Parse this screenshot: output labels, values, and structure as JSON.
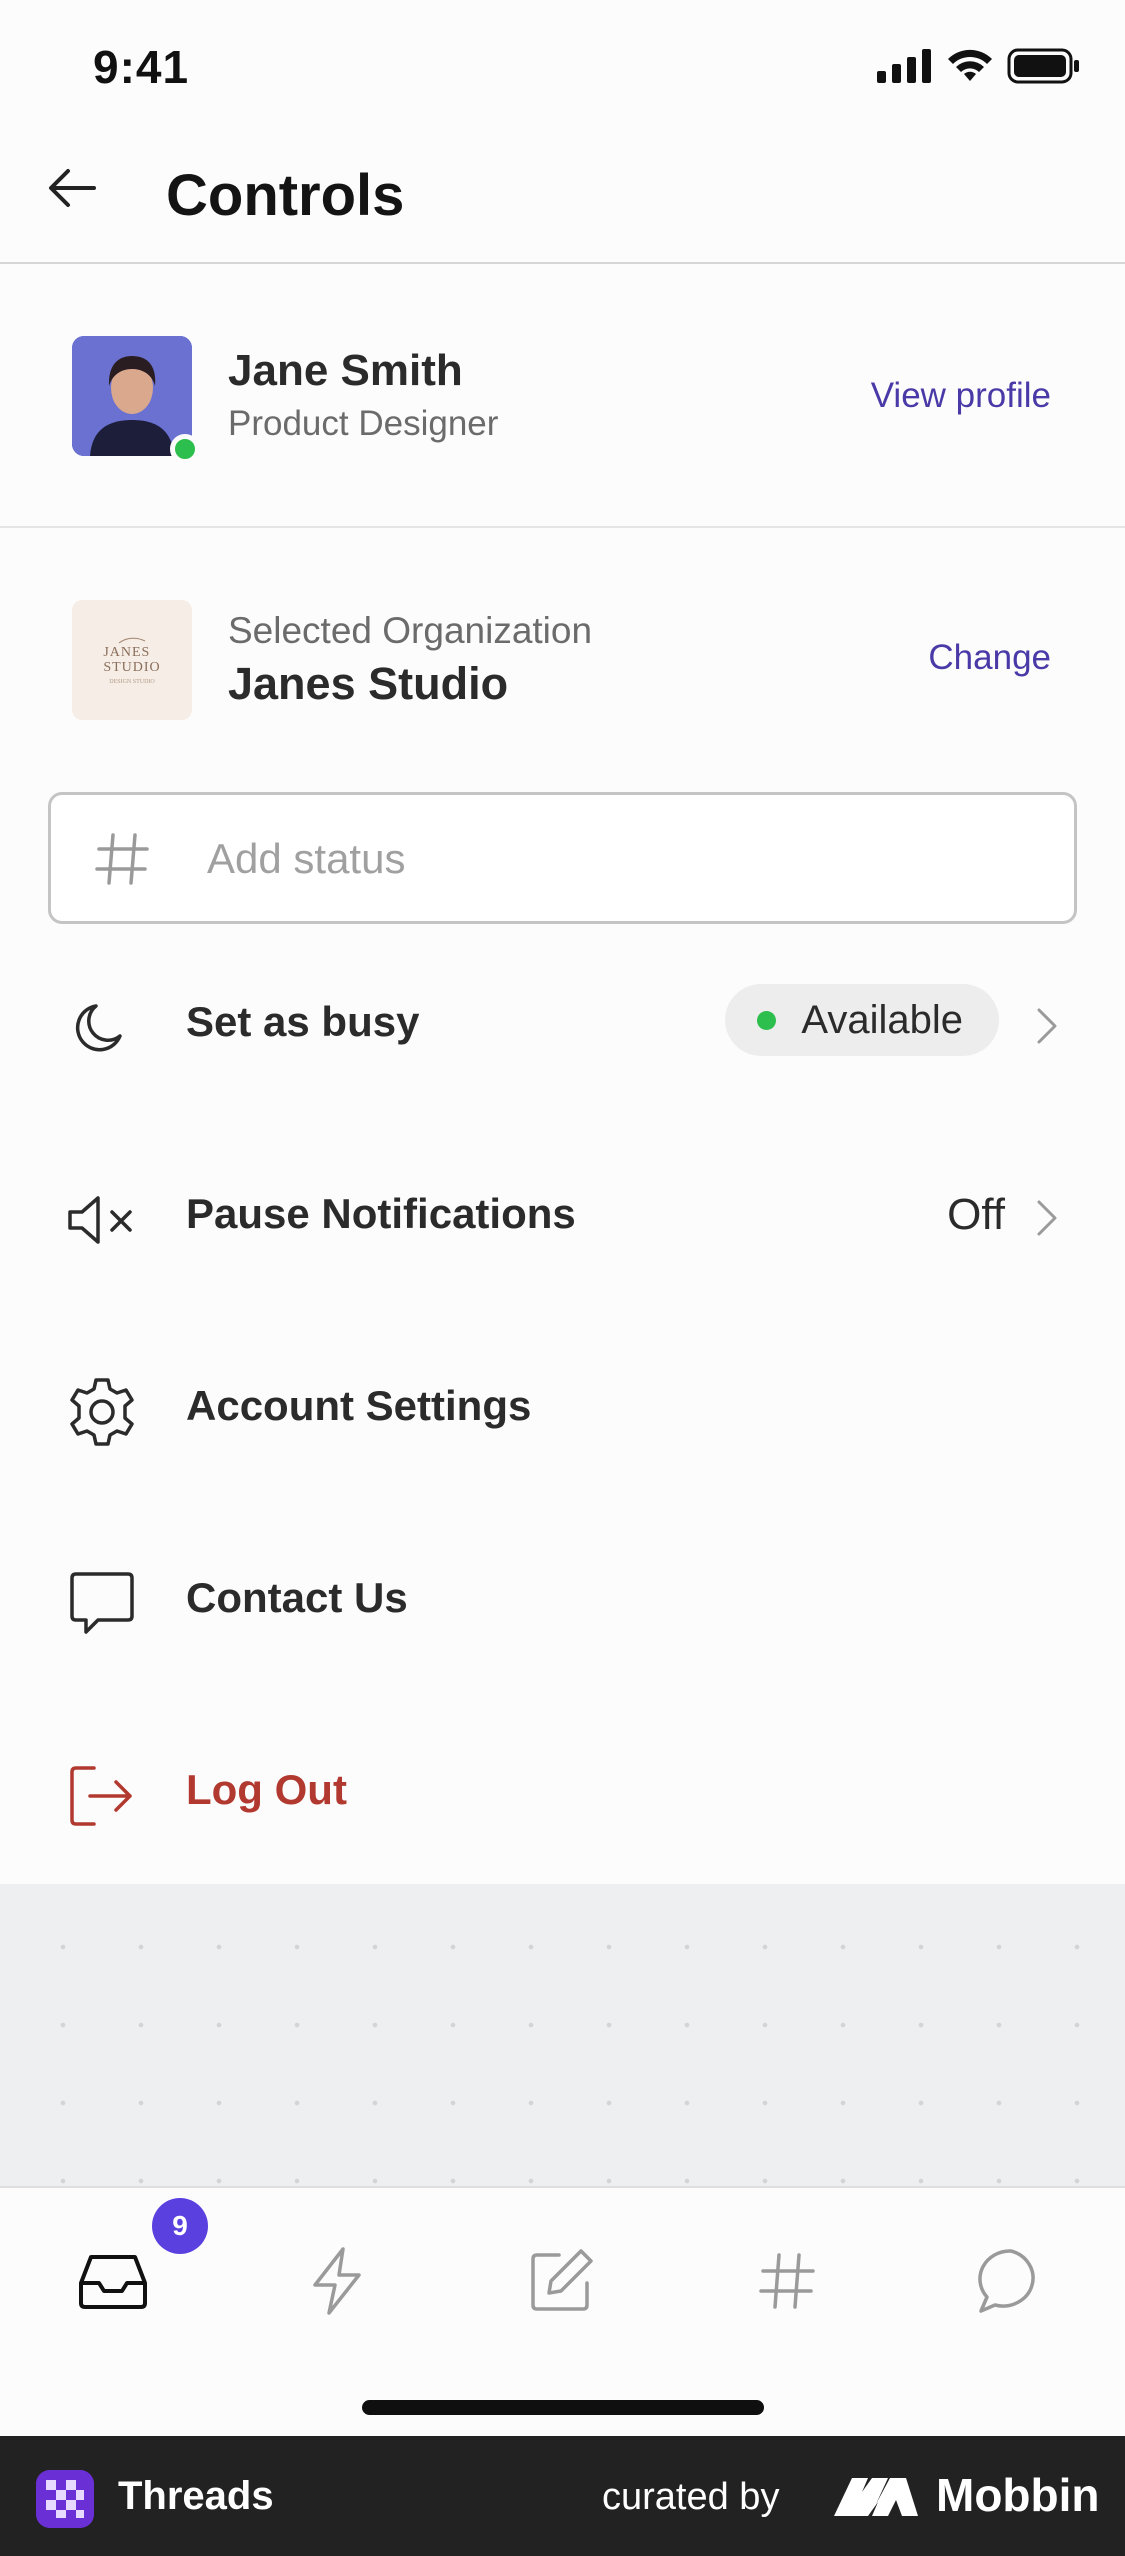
{
  "status_bar": {
    "time": "9:41"
  },
  "header": {
    "title": "Controls",
    "back_icon": "arrow-left-icon"
  },
  "profile": {
    "name": "Jane Smith",
    "role": "Product Designer",
    "presence": "online",
    "view_profile_label": "View profile"
  },
  "organization": {
    "caption": "Selected Organization",
    "name": "Janes Studio",
    "logo_text": "JANES STUDIO",
    "change_label": "Change"
  },
  "status_input": {
    "placeholder": "Add status",
    "icon": "hash-icon"
  },
  "menu": {
    "busy": {
      "label": "Set as busy",
      "icon": "moon-icon",
      "value": "Available"
    },
    "notifications": {
      "label": "Pause Notifications",
      "icon": "speaker-muted-icon",
      "value": "Off"
    },
    "settings": {
      "label": "Account Settings",
      "icon": "gear-icon"
    },
    "contact": {
      "label": "Contact Us",
      "icon": "chat-bubble-icon"
    },
    "logout": {
      "label": "Log Out",
      "icon": "logout-icon"
    }
  },
  "tabbar": {
    "inbox_badge": "9",
    "tabs": [
      "inbox-icon",
      "lightning-icon",
      "compose-icon",
      "hash-icon",
      "chat-icon"
    ]
  },
  "footer": {
    "app_name": "Threads",
    "curated_by": "curated by",
    "brand": "Mobbin"
  },
  "colors": {
    "accent": "#4a3aa8",
    "badge": "#5b40e0",
    "online": "#2dbf4e",
    "danger": "#b2392f"
  }
}
